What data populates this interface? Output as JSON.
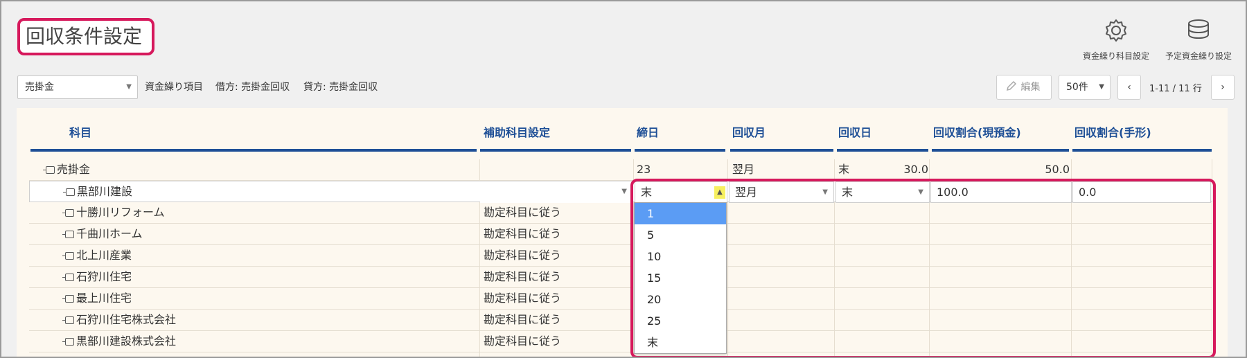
{
  "page": {
    "title": "回収条件設定"
  },
  "top_actions": [
    {
      "label": "資金繰り科目設定",
      "icon": "gear-icon"
    },
    {
      "label": "予定資金繰り設定",
      "icon": "coins-icon"
    }
  ],
  "filter": {
    "account": "売掛金",
    "cf_item_label": "資金繰り項目",
    "debit": "借方: 売掛金回収",
    "credit": "貸方: 売掛金回収"
  },
  "toolbar": {
    "edit_label": "編集",
    "per_page": "50件",
    "pagination": "1-11 / 11 行"
  },
  "table": {
    "headers": [
      "科目",
      "補助科目設定",
      "締日",
      "回収月",
      "回収日",
      "回収割合(現預金)",
      "回収割合(手形)"
    ],
    "parent_row": {
      "name": "売掛金",
      "sub": "",
      "closing": "23",
      "month": "翌月",
      "day": "末",
      "cash": "30.0",
      "bill": "50.0"
    },
    "edit_row": {
      "name": "黒部川建設",
      "sub": "",
      "closing": "末",
      "month": "翌月",
      "day": "末",
      "cash": "100.0",
      "bill": "0.0"
    },
    "rows": [
      {
        "name": "十勝川リフォーム",
        "sub": "勘定科目に従う"
      },
      {
        "name": "千曲川ホーム",
        "sub": "勘定科目に従う"
      },
      {
        "name": "北上川産業",
        "sub": "勘定科目に従う"
      },
      {
        "name": "石狩川住宅",
        "sub": "勘定科目に従う"
      },
      {
        "name": "最上川住宅",
        "sub": "勘定科目に従う"
      },
      {
        "name": "石狩川住宅株式会社",
        "sub": "勘定科目に従う"
      },
      {
        "name": "黒部川建設株式会社",
        "sub": "勘定科目に従う"
      }
    ]
  },
  "closing_dropdown": {
    "options": [
      "1",
      "5",
      "10",
      "15",
      "20",
      "25",
      "末"
    ],
    "highlighted": "1"
  },
  "colors": {
    "accent_pink": "#d6195c",
    "header_blue": "#1e4f96",
    "panel_bg": "#fdf8ef",
    "selected_option": "#5b9cf4"
  }
}
